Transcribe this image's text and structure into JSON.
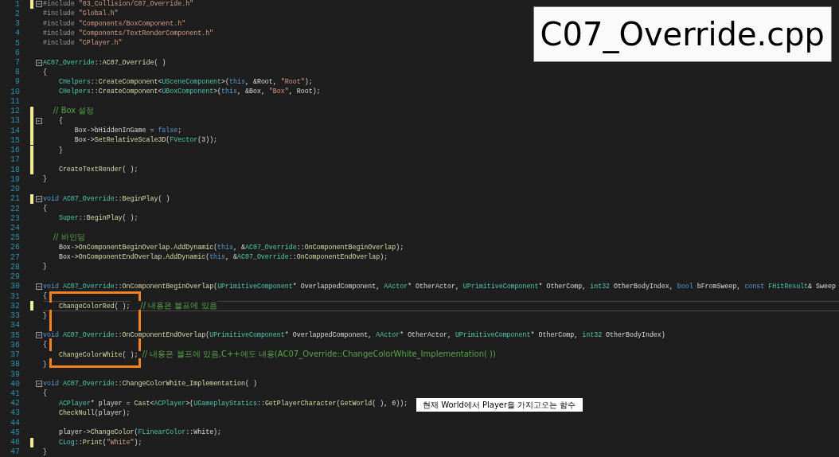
{
  "file_label": "C07_Override.cpp",
  "note": "현재 World에서 Player을 가지고오는 함수",
  "lines": [
    {
      "n": "1",
      "modified": true,
      "fold": true,
      "current": false,
      "tokens": [
        {
          "kind": "pre",
          "text": "#include "
        },
        {
          "kind": "str",
          "text": "\"03_Collision/C07_Override.h\""
        }
      ]
    },
    {
      "n": "2",
      "modified": false,
      "fold": false,
      "current": false,
      "tokens": [
        {
          "kind": "pre",
          "text": "#include "
        },
        {
          "kind": "str",
          "text": "\"Global.h\""
        }
      ]
    },
    {
      "n": "3",
      "modified": false,
      "fold": false,
      "current": false,
      "tokens": [
        {
          "kind": "pre",
          "text": "#include "
        },
        {
          "kind": "str",
          "text": "\"Components/BoxComponent.h\""
        }
      ]
    },
    {
      "n": "4",
      "modified": false,
      "fold": false,
      "current": false,
      "tokens": [
        {
          "kind": "pre",
          "text": "#include "
        },
        {
          "kind": "str",
          "text": "\"Components/TextRenderComponent.h\""
        }
      ]
    },
    {
      "n": "5",
      "modified": false,
      "fold": false,
      "current": false,
      "tokens": [
        {
          "kind": "pre",
          "text": "#include "
        },
        {
          "kind": "str",
          "text": "\"CPlayer.h\""
        }
      ]
    },
    {
      "n": "6",
      "modified": false,
      "fold": false,
      "current": false
    },
    {
      "n": "7",
      "modified": false,
      "fold": true,
      "current": false,
      "tokens": [
        {
          "kind": "type",
          "text": "AC07_Override"
        },
        {
          "kind": "plain",
          "text": "::"
        },
        {
          "kind": "func",
          "text": "AC07_Override"
        },
        {
          "kind": "plain",
          "text": "( )"
        }
      ]
    },
    {
      "n": "8",
      "modified": false,
      "fold": false,
      "current": false,
      "tokens": [
        {
          "kind": "plain",
          "text": "{"
        }
      ]
    },
    {
      "n": "9",
      "modified": false,
      "fold": false,
      "current": false,
      "tokens": [
        {
          "kind": "type",
          "text": "    CHelpers"
        },
        {
          "kind": "plain",
          "text": "::"
        },
        {
          "kind": "func",
          "text": "CreateComponent"
        },
        {
          "kind": "plain",
          "text": "<"
        },
        {
          "kind": "type",
          "text": "USceneComponent"
        },
        {
          "kind": "plain",
          "text": ">("
        },
        {
          "kind": "kw",
          "text": "this"
        },
        {
          "kind": "plain",
          "text": ", &Root, "
        },
        {
          "kind": "str",
          "text": "\"Root\""
        },
        {
          "kind": "plain",
          "text": ");"
        }
      ]
    },
    {
      "n": "10",
      "modified": false,
      "fold": false,
      "current": false,
      "tokens": [
        {
          "kind": "type",
          "text": "    CHelpers"
        },
        {
          "kind": "plain",
          "text": "::"
        },
        {
          "kind": "func",
          "text": "CreateComponent"
        },
        {
          "kind": "plain",
          "text": "<"
        },
        {
          "kind": "type",
          "text": "UBoxComponent"
        },
        {
          "kind": "plain",
          "text": ">("
        },
        {
          "kind": "kw",
          "text": "this"
        },
        {
          "kind": "plain",
          "text": ", &Box, "
        },
        {
          "kind": "str",
          "text": "\"Box\""
        },
        {
          "kind": "plain",
          "text": ", Root);"
        }
      ]
    },
    {
      "n": "11",
      "modified": false,
      "fold": false,
      "current": false
    },
    {
      "n": "12",
      "modified": true,
      "fold": false,
      "current": false,
      "tokens": [
        {
          "kind": "comment",
          "text": "    // Box 설정"
        }
      ]
    },
    {
      "n": "13",
      "modified": true,
      "fold": true,
      "current": false,
      "tokens": [
        {
          "kind": "plain",
          "text": "    {"
        }
      ]
    },
    {
      "n": "14",
      "modified": true,
      "fold": false,
      "current": false,
      "tokens": [
        {
          "kind": "plain",
          "text": "        Box->bHiddenInGame = "
        },
        {
          "kind": "kw",
          "text": "false"
        },
        {
          "kind": "plain",
          "text": ";"
        }
      ]
    },
    {
      "n": "15",
      "modified": true,
      "fold": false,
      "current": false,
      "tokens": [
        {
          "kind": "plain",
          "text": "        Box->"
        },
        {
          "kind": "func",
          "text": "SetRelativeScale3D"
        },
        {
          "kind": "plain",
          "text": "("
        },
        {
          "kind": "type",
          "text": "FVector"
        },
        {
          "kind": "plain",
          "text": "(3));"
        }
      ]
    },
    {
      "n": "16",
      "modified": true,
      "fold": false,
      "current": false,
      "tokens": [
        {
          "kind": "plain",
          "text": "    }"
        }
      ]
    },
    {
      "n": "17",
      "modified": true,
      "fold": false,
      "current": false
    },
    {
      "n": "18",
      "modified": true,
      "fold": false,
      "current": false,
      "tokens": [
        {
          "kind": "func",
          "text": "    CreateTextRender"
        },
        {
          "kind": "plain",
          "text": "( );"
        }
      ]
    },
    {
      "n": "19",
      "modified": false,
      "fold": false,
      "current": false,
      "tokens": [
        {
          "kind": "plain",
          "text": "}"
        }
      ]
    },
    {
      "n": "20",
      "modified": false,
      "fold": false,
      "current": false
    },
    {
      "n": "21",
      "modified": true,
      "fold": true,
      "current": false,
      "tokens": [
        {
          "kind": "kw",
          "text": "void "
        },
        {
          "kind": "type",
          "text": "AC07_Override"
        },
        {
          "kind": "plain",
          "text": "::"
        },
        {
          "kind": "func",
          "text": "BeginPlay"
        },
        {
          "kind": "plain",
          "text": "( )"
        }
      ]
    },
    {
      "n": "22",
      "modified": false,
      "fold": false,
      "current": false,
      "tokens": [
        {
          "kind": "plain",
          "text": "{"
        }
      ]
    },
    {
      "n": "23",
      "modified": false,
      "fold": false,
      "current": false,
      "tokens": [
        {
          "kind": "type",
          "text": "    Super"
        },
        {
          "kind": "plain",
          "text": "::"
        },
        {
          "kind": "func",
          "text": "BeginPlay"
        },
        {
          "kind": "plain",
          "text": "( );"
        }
      ]
    },
    {
      "n": "24",
      "modified": false,
      "fold": false,
      "current": false
    },
    {
      "n": "25",
      "modified": false,
      "fold": false,
      "current": false,
      "tokens": [
        {
          "kind": "comment",
          "text": "    // 바인딩"
        }
      ]
    },
    {
      "n": "26",
      "modified": false,
      "fold": false,
      "current": false,
      "tokens": [
        {
          "kind": "plain",
          "text": "    Box->"
        },
        {
          "kind": "func",
          "text": "OnComponentBeginOverlap"
        },
        {
          "kind": "plain",
          "text": "."
        },
        {
          "kind": "func",
          "text": "AddDynamic"
        },
        {
          "kind": "plain",
          "text": "("
        },
        {
          "kind": "kw",
          "text": "this"
        },
        {
          "kind": "plain",
          "text": ", &"
        },
        {
          "kind": "type",
          "text": "AC07_Override"
        },
        {
          "kind": "plain",
          "text": "::"
        },
        {
          "kind": "func",
          "text": "OnComponentBeginOverlap"
        },
        {
          "kind": "plain",
          "text": ");"
        }
      ]
    },
    {
      "n": "27",
      "modified": false,
      "fold": false,
      "current": false,
      "tokens": [
        {
          "kind": "plain",
          "text": "    Box->"
        },
        {
          "kind": "func",
          "text": "OnComponentEndOverlap"
        },
        {
          "kind": "plain",
          "text": "."
        },
        {
          "kind": "func",
          "text": "AddDynamic"
        },
        {
          "kind": "plain",
          "text": "("
        },
        {
          "kind": "kw",
          "text": "this"
        },
        {
          "kind": "plain",
          "text": ", &"
        },
        {
          "kind": "type",
          "text": "AC07_Override"
        },
        {
          "kind": "plain",
          "text": "::"
        },
        {
          "kind": "func",
          "text": "OnComponentEndOverlap"
        },
        {
          "kind": "plain",
          "text": ");"
        }
      ]
    },
    {
      "n": "28",
      "modified": false,
      "fold": false,
      "current": false,
      "tokens": [
        {
          "kind": "plain",
          "text": "}"
        }
      ]
    },
    {
      "n": "29",
      "modified": false,
      "fold": false,
      "current": false
    },
    {
      "n": "30",
      "modified": false,
      "fold": true,
      "current": false,
      "tokens": [
        {
          "kind": "kw",
          "text": "void "
        },
        {
          "kind": "type",
          "text": "AC07_Override"
        },
        {
          "kind": "plain",
          "text": "::"
        },
        {
          "kind": "func",
          "text": "OnComponentBeginOverlap"
        },
        {
          "kind": "plain",
          "text": "("
        },
        {
          "kind": "type",
          "text": "UPrimitiveComponent"
        },
        {
          "kind": "plain",
          "text": "* OverlappedComponent, "
        },
        {
          "kind": "type",
          "text": "AActor"
        },
        {
          "kind": "plain",
          "text": "* OtherActor, "
        },
        {
          "kind": "type",
          "text": "UPrimitiveComponent"
        },
        {
          "kind": "plain",
          "text": "* OtherComp, "
        },
        {
          "kind": "type",
          "text": "int32"
        },
        {
          "kind": "plain",
          "text": " OtherBodyIndex, "
        },
        {
          "kind": "kw",
          "text": "bool"
        },
        {
          "kind": "plain",
          "text": " bFromSweep, "
        },
        {
          "kind": "kw",
          "text": "const "
        },
        {
          "kind": "type",
          "text": "FHitResult"
        },
        {
          "kind": "plain",
          "text": "& Sweep"
        }
      ]
    },
    {
      "n": "31",
      "modified": false,
      "fold": false,
      "current": false,
      "tokens": [
        {
          "kind": "plain",
          "text": "{"
        }
      ]
    },
    {
      "n": "32",
      "modified": true,
      "fold": false,
      "current": true,
      "tokens": [
        {
          "kind": "func",
          "text": "    ChangeColorRed"
        },
        {
          "kind": "plain",
          "text": "( );"
        },
        {
          "kind": "comment",
          "text": "    // 내용은 블프에 있음"
        }
      ]
    },
    {
      "n": "33",
      "modified": false,
      "fold": false,
      "current": false,
      "tokens": [
        {
          "kind": "plain",
          "text": "}"
        }
      ]
    },
    {
      "n": "34",
      "modified": false,
      "fold": false,
      "current": false
    },
    {
      "n": "35",
      "modified": false,
      "fold": true,
      "current": false,
      "tokens": [
        {
          "kind": "kw",
          "text": "void "
        },
        {
          "kind": "type",
          "text": "AC07_Override"
        },
        {
          "kind": "plain",
          "text": "::"
        },
        {
          "kind": "func",
          "text": "OnComponentEndOverlap"
        },
        {
          "kind": "plain",
          "text": "("
        },
        {
          "kind": "type",
          "text": "UPrimitiveComponent"
        },
        {
          "kind": "plain",
          "text": "* OverlappedComponent, "
        },
        {
          "kind": "type",
          "text": "AActor"
        },
        {
          "kind": "plain",
          "text": "* OtherActor, "
        },
        {
          "kind": "type",
          "text": "UPrimitiveComponent"
        },
        {
          "kind": "plain",
          "text": "* OtherComp, "
        },
        {
          "kind": "type",
          "text": "int32"
        },
        {
          "kind": "plain",
          "text": " OtherBodyIndex)"
        }
      ]
    },
    {
      "n": "36",
      "modified": false,
      "fold": false,
      "current": false,
      "tokens": [
        {
          "kind": "plain",
          "text": "{"
        }
      ]
    },
    {
      "n": "37",
      "modified": false,
      "fold": false,
      "current": false,
      "tokens": [
        {
          "kind": "func",
          "text": "    ChangeColorWhite"
        },
        {
          "kind": "plain",
          "text": "( ); "
        },
        {
          "kind": "comment",
          "text": "// 내용은 블프에 있음,C++에도 내용(AC07_Override::ChangeColorWhite_Implementation( ))"
        }
      ]
    },
    {
      "n": "38",
      "modified": false,
      "fold": false,
      "current": false,
      "tokens": [
        {
          "kind": "plain",
          "text": "}"
        }
      ]
    },
    {
      "n": "39",
      "modified": false,
      "fold": false,
      "current": false
    },
    {
      "n": "40",
      "modified": false,
      "fold": true,
      "current": false,
      "tokens": [
        {
          "kind": "kw",
          "text": "void "
        },
        {
          "kind": "type",
          "text": "AC07_Override"
        },
        {
          "kind": "plain",
          "text": "::"
        },
        {
          "kind": "func",
          "text": "ChangeColorWhite_Implementation"
        },
        {
          "kind": "plain",
          "text": "( )"
        }
      ]
    },
    {
      "n": "41",
      "modified": false,
      "fold": false,
      "current": false,
      "tokens": [
        {
          "kind": "plain",
          "text": "{"
        }
      ]
    },
    {
      "n": "42",
      "modified": false,
      "fold": false,
      "current": false,
      "tokens": [
        {
          "kind": "type",
          "text": "    ACPlayer"
        },
        {
          "kind": "plain",
          "text": "* player = "
        },
        {
          "kind": "func",
          "text": "Cast"
        },
        {
          "kind": "plain",
          "text": "<"
        },
        {
          "kind": "type",
          "text": "ACPlayer"
        },
        {
          "kind": "plain",
          "text": ">("
        },
        {
          "kind": "type",
          "text": "UGameplayStatics"
        },
        {
          "kind": "plain",
          "text": "::"
        },
        {
          "kind": "func",
          "text": "GetPlayerCharacter"
        },
        {
          "kind": "plain",
          "text": "("
        },
        {
          "kind": "func",
          "text": "GetWorld"
        },
        {
          "kind": "plain",
          "text": "( ), 0));"
        }
      ]
    },
    {
      "n": "43",
      "modified": false,
      "fold": false,
      "current": false,
      "tokens": [
        {
          "kind": "func",
          "text": "    CheckNull"
        },
        {
          "kind": "plain",
          "text": "(player);"
        }
      ]
    },
    {
      "n": "44",
      "modified": false,
      "fold": false,
      "current": false
    },
    {
      "n": "45",
      "modified": false,
      "fold": false,
      "current": false,
      "tokens": [
        {
          "kind": "plain",
          "text": "    player->"
        },
        {
          "kind": "func",
          "text": "ChangeColor"
        },
        {
          "kind": "plain",
          "text": "("
        },
        {
          "kind": "type",
          "text": "FLinearColor"
        },
        {
          "kind": "plain",
          "text": "::White);"
        }
      ]
    },
    {
      "n": "46",
      "modified": true,
      "fold": false,
      "current": false,
      "tokens": [
        {
          "kind": "type",
          "text": "    CLog"
        },
        {
          "kind": "plain",
          "text": "::"
        },
        {
          "kind": "func",
          "text": "Print"
        },
        {
          "kind": "plain",
          "text": "("
        },
        {
          "kind": "str",
          "text": "\"White\""
        },
        {
          "kind": "plain",
          "text": ");"
        }
      ]
    },
    {
      "n": "47",
      "modified": false,
      "fold": false,
      "current": false,
      "tokens": [
        {
          "kind": "plain",
          "text": "}"
        }
      ]
    }
  ]
}
